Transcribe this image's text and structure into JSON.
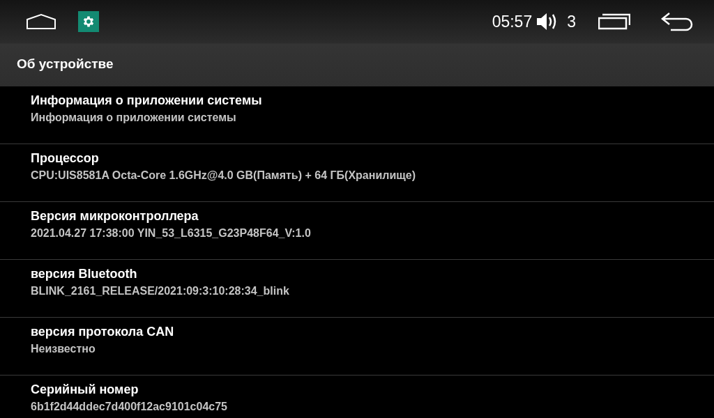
{
  "status_bar": {
    "time": "05:57",
    "volume": "3"
  },
  "title_bar": {
    "title": "Об устройстве"
  },
  "items": [
    {
      "title": "Информация о приложении системы",
      "value": "Информация о приложении системы"
    },
    {
      "title": "Процессор",
      "value": "CPU:UIS8581A Octa-Core 1.6GHz@4.0 GB(Память) + 64 ГБ(Хранилище)"
    },
    {
      "title": "Версия микроконтроллера",
      "value": "2021.04.27 17:38:00 YIN_53_L6315_G23P48F64_V:1.0"
    },
    {
      "title": "версия Bluetooth",
      "value": "BLINK_2161_RELEASE/2021:09:3:10:28:34_blink"
    },
    {
      "title": "версия протокола CAN",
      "value": "Неизвестно"
    },
    {
      "title": "Серийный номер",
      "value": "6b1f2d44ddec7d400f12ac9101c04c75"
    }
  ]
}
